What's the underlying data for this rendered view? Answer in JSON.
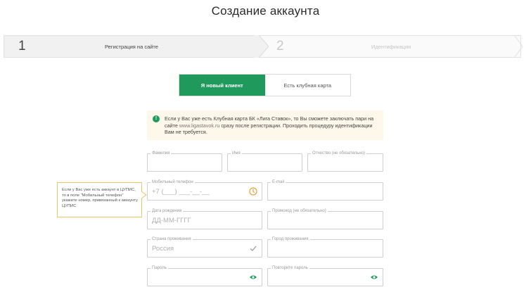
{
  "page": {
    "title": "Создание аккаунта"
  },
  "stepper": {
    "steps": [
      {
        "number": "1",
        "label": "Регистрация на сайте",
        "state": "active"
      },
      {
        "number": "2",
        "label": "Идентификация",
        "state": "inactive"
      }
    ]
  },
  "tabs": [
    {
      "label": "Я новый клиент",
      "active": true
    },
    {
      "label": "Есть клубная карта",
      "active": false
    }
  ],
  "notice": {
    "icon": "info-icon",
    "text_before_link": "Если у Вас уже есть Клубная карта БК «Лига Ставок», то Вы сможете заключать пари на сайте ",
    "link": "www.ligastavok.ru",
    "text_after_link": " сразу после регистрации. Проходить процедуру идентификации Вам не требуется."
  },
  "tooltip": {
    "text": "Если у Вас уже есть аккаунт в ЦУПИС, то в поле \"Мобильный телефон\" укажите номер, привязанный к аккаунту ЦУПИС"
  },
  "form": {
    "last_name": {
      "label": "Фамилия",
      "value": ""
    },
    "first_name": {
      "label": "Имя",
      "value": ""
    },
    "patronymic": {
      "label": "Отчество (не обязательно)",
      "value": ""
    },
    "phone": {
      "label": "Мобильный телефон",
      "value": "+7 (___) ___-__-__",
      "icon": "clock-warning-icon"
    },
    "email": {
      "label": "E-mail",
      "value": ""
    },
    "birth_date": {
      "label": "Дата рождения",
      "placeholder": "ДД-ММ-ГГГГ"
    },
    "promo_code": {
      "label": "Промокод (не обязательно)",
      "value": ""
    },
    "country": {
      "label": "Страна проживания",
      "value": "Россия",
      "icon": "checkmark-icon"
    },
    "city": {
      "label": "Город проживания",
      "value": ""
    },
    "password": {
      "label": "Пароль",
      "value": "",
      "icon": "eye-icon"
    },
    "password_repeat": {
      "label": "Повторите пароль",
      "value": "",
      "icon": "eye-icon"
    }
  },
  "colors": {
    "accent": "#1f9a5c",
    "notice_bg": "#fdf8ea",
    "warning": "#e0a43a"
  }
}
